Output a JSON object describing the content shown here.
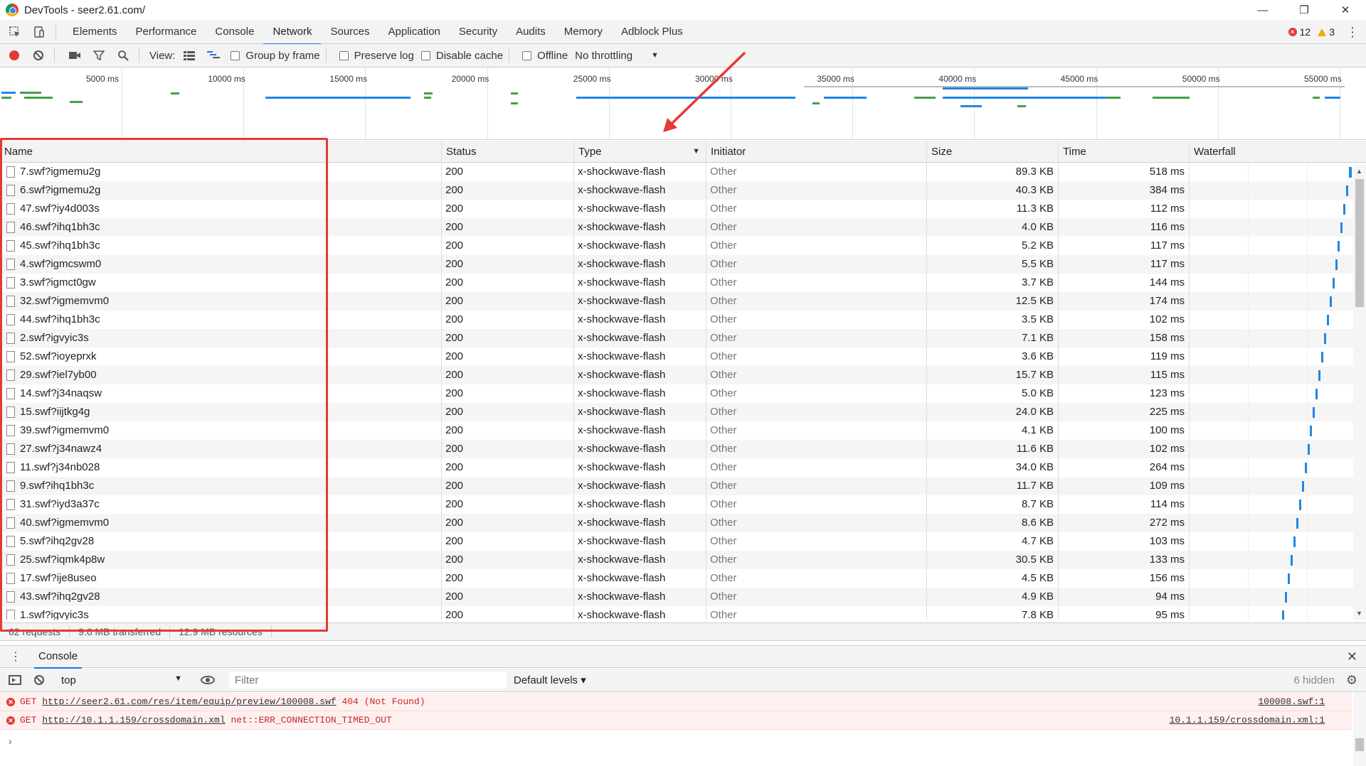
{
  "window": {
    "title": "DevTools - seer2.61.com/",
    "controls": [
      "—",
      "❐",
      "✕"
    ]
  },
  "tabs": [
    {
      "label": "Elements"
    },
    {
      "label": "Performance"
    },
    {
      "label": "Console"
    },
    {
      "label": "Network",
      "active": true
    },
    {
      "label": "Sources"
    },
    {
      "label": "Application"
    },
    {
      "label": "Security"
    },
    {
      "label": "Audits"
    },
    {
      "label": "Memory"
    },
    {
      "label": "Adblock Plus"
    }
  ],
  "counts": {
    "errors": "12",
    "warnings": "3"
  },
  "toolbar": {
    "view_label": "View:",
    "group_by_frame": "Group by frame",
    "preserve_log": "Preserve log",
    "disable_cache": "Disable cache",
    "offline": "Offline",
    "throttling": "No throttling"
  },
  "overview": {
    "ticks": [
      "5000 ms",
      "10000 ms",
      "15000 ms",
      "20000 ms",
      "25000 ms",
      "30000 ms",
      "35000 ms",
      "40000 ms",
      "45000 ms",
      "50000 ms",
      "55000 ms"
    ]
  },
  "table": {
    "headers": {
      "name": "Name",
      "status": "Status",
      "type": "Type",
      "initiator": "Initiator",
      "size": "Size",
      "time": "Time",
      "waterfall": "Waterfall"
    },
    "rows": [
      {
        "name": "7.swf?igmemu2g",
        "status": "200",
        "type": "x-shockwave-flash",
        "initiator": "Other",
        "size": "89.3 KB",
        "time": "518 ms"
      },
      {
        "name": "6.swf?igmemu2g",
        "status": "200",
        "type": "x-shockwave-flash",
        "initiator": "Other",
        "size": "40.3 KB",
        "time": "384 ms"
      },
      {
        "name": "47.swf?iy4d003s",
        "status": "200",
        "type": "x-shockwave-flash",
        "initiator": "Other",
        "size": "11.3 KB",
        "time": "112 ms"
      },
      {
        "name": "46.swf?ihq1bh3c",
        "status": "200",
        "type": "x-shockwave-flash",
        "initiator": "Other",
        "size": "4.0 KB",
        "time": "116 ms"
      },
      {
        "name": "45.swf?ihq1bh3c",
        "status": "200",
        "type": "x-shockwave-flash",
        "initiator": "Other",
        "size": "5.2 KB",
        "time": "117 ms"
      },
      {
        "name": "4.swf?igmcswm0",
        "status": "200",
        "type": "x-shockwave-flash",
        "initiator": "Other",
        "size": "5.5 KB",
        "time": "117 ms"
      },
      {
        "name": "3.swf?igmct0gw",
        "status": "200",
        "type": "x-shockwave-flash",
        "initiator": "Other",
        "size": "3.7 KB",
        "time": "144 ms"
      },
      {
        "name": "32.swf?igmemvm0",
        "status": "200",
        "type": "x-shockwave-flash",
        "initiator": "Other",
        "size": "12.5 KB",
        "time": "174 ms"
      },
      {
        "name": "44.swf?ihq1bh3c",
        "status": "200",
        "type": "x-shockwave-flash",
        "initiator": "Other",
        "size": "3.5 KB",
        "time": "102 ms"
      },
      {
        "name": "2.swf?igvyic3s",
        "status": "200",
        "type": "x-shockwave-flash",
        "initiator": "Other",
        "size": "7.1 KB",
        "time": "158 ms"
      },
      {
        "name": "52.swf?ioyeprxk",
        "status": "200",
        "type": "x-shockwave-flash",
        "initiator": "Other",
        "size": "3.6 KB",
        "time": "119 ms"
      },
      {
        "name": "29.swf?iel7yb00",
        "status": "200",
        "type": "x-shockwave-flash",
        "initiator": "Other",
        "size": "15.7 KB",
        "time": "115 ms"
      },
      {
        "name": "14.swf?j34naqsw",
        "status": "200",
        "type": "x-shockwave-flash",
        "initiator": "Other",
        "size": "5.0 KB",
        "time": "123 ms"
      },
      {
        "name": "15.swf?iijtkg4g",
        "status": "200",
        "type": "x-shockwave-flash",
        "initiator": "Other",
        "size": "24.0 KB",
        "time": "225 ms"
      },
      {
        "name": "39.swf?igmemvm0",
        "status": "200",
        "type": "x-shockwave-flash",
        "initiator": "Other",
        "size": "4.1 KB",
        "time": "100 ms"
      },
      {
        "name": "27.swf?j34nawz4",
        "status": "200",
        "type": "x-shockwave-flash",
        "initiator": "Other",
        "size": "11.6 KB",
        "time": "102 ms"
      },
      {
        "name": "11.swf?j34nb028",
        "status": "200",
        "type": "x-shockwave-flash",
        "initiator": "Other",
        "size": "34.0 KB",
        "time": "264 ms"
      },
      {
        "name": "9.swf?ihq1bh3c",
        "status": "200",
        "type": "x-shockwave-flash",
        "initiator": "Other",
        "size": "11.7 KB",
        "time": "109 ms"
      },
      {
        "name": "31.swf?iyd3a37c",
        "status": "200",
        "type": "x-shockwave-flash",
        "initiator": "Other",
        "size": "8.7 KB",
        "time": "114 ms"
      },
      {
        "name": "40.swf?igmemvm0",
        "status": "200",
        "type": "x-shockwave-flash",
        "initiator": "Other",
        "size": "8.6 KB",
        "time": "272 ms"
      },
      {
        "name": "5.swf?ihq2gv28",
        "status": "200",
        "type": "x-shockwave-flash",
        "initiator": "Other",
        "size": "4.7 KB",
        "time": "103 ms"
      },
      {
        "name": "25.swf?iqmk4p8w",
        "status": "200",
        "type": "x-shockwave-flash",
        "initiator": "Other",
        "size": "30.5 KB",
        "time": "133 ms"
      },
      {
        "name": "17.swf?ije8useo",
        "status": "200",
        "type": "x-shockwave-flash",
        "initiator": "Other",
        "size": "4.5 KB",
        "time": "156 ms"
      },
      {
        "name": "43.swf?ihq2gv28",
        "status": "200",
        "type": "x-shockwave-flash",
        "initiator": "Other",
        "size": "4.9 KB",
        "time": "94 ms"
      },
      {
        "name": "1.swf?igvyic3s",
        "status": "200",
        "type": "x-shockwave-flash",
        "initiator": "Other",
        "size": "7.8 KB",
        "time": "95 ms"
      }
    ]
  },
  "status_bar": {
    "requests": "62 requests",
    "transferred": "9.6 MB transferred",
    "resources": "12.9 MB resources"
  },
  "drawer": {
    "tab": "Console",
    "context": "top",
    "filter_placeholder": "Filter",
    "levels": "Default levels",
    "hidden": "6 hidden"
  },
  "console_messages": [
    {
      "method": "GET",
      "url": "http://seer2.61.com/res/item/equip/preview/100008.swf",
      "detail": "404 (Not Found)",
      "source": "100008.swf:1"
    },
    {
      "method": "GET",
      "url": "http://10.1.1.159/crossdomain.xml",
      "detail": "net::ERR_CONNECTION_TIMED_OUT",
      "source": "10.1.1.159/crossdomain.xml:1"
    }
  ],
  "colors": {
    "accent": "#1a73e8",
    "error": "#e53935",
    "highlight": "#e53935",
    "waterfall": "#1e88e5"
  }
}
